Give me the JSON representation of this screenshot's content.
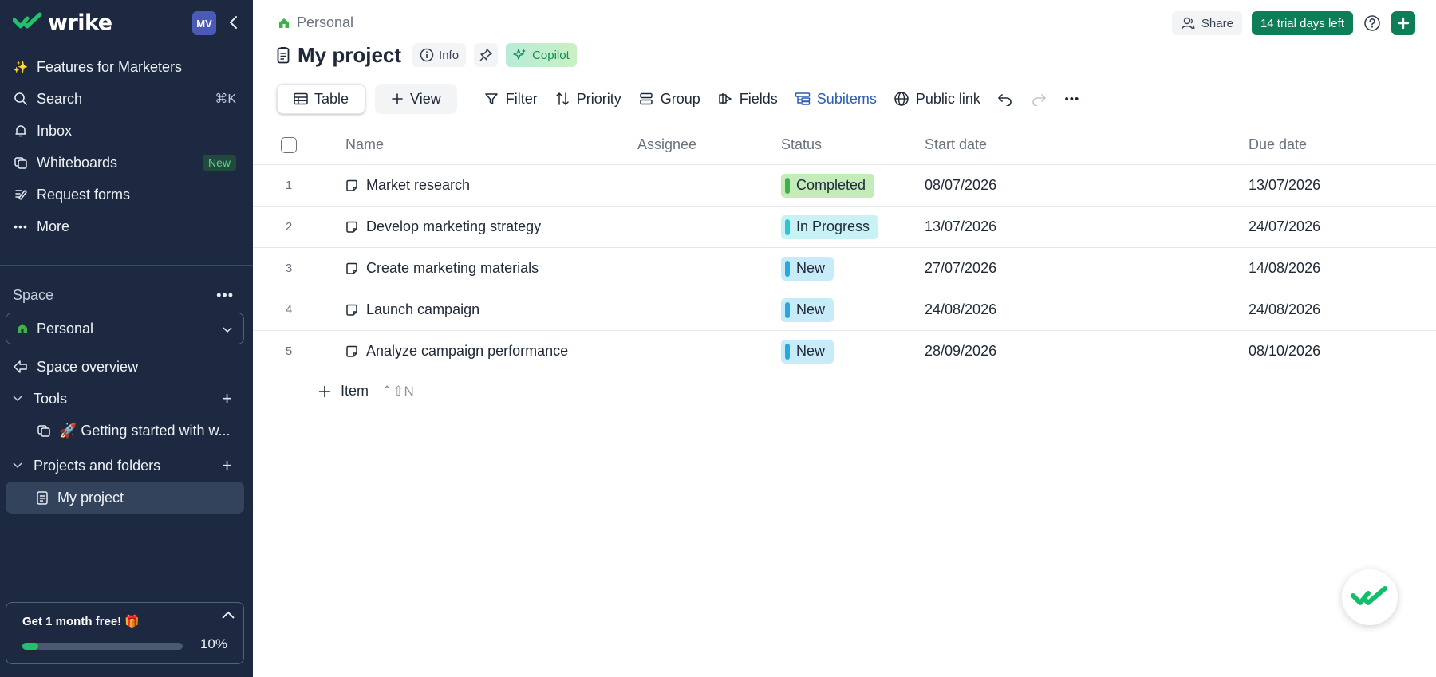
{
  "brand": {
    "name": "wrike",
    "accent": "#0d7e58",
    "sidebar_bg": "#1c2940"
  },
  "user": {
    "initials": "MV"
  },
  "sidebar": {
    "nav": [
      {
        "label": "Features for Marketers",
        "icon": "sparkle-icon"
      },
      {
        "label": "Search",
        "icon": "search-icon",
        "shortcut": "⌘K"
      },
      {
        "label": "Inbox",
        "icon": "bell-icon"
      },
      {
        "label": "Whiteboards",
        "icon": "whiteboard-icon",
        "badge": "New"
      },
      {
        "label": "Request forms",
        "icon": "form-icon"
      },
      {
        "label": "More",
        "icon": "more-icon"
      }
    ],
    "space_heading": "Space",
    "space_selected": "Personal",
    "space_overview": "Space overview",
    "tools_heading": "Tools",
    "tools_item": "🚀 Getting started with w...",
    "projects_heading": "Projects and folders",
    "projects_item": "My project",
    "promo": {
      "title": "Get 1 month free! 🎁",
      "progress_label": "10%",
      "progress": 0.1
    }
  },
  "header": {
    "breadcrumb": "Personal",
    "title": "My project",
    "info_label": "Info",
    "copilot_label": "Copilot",
    "share_label": "Share",
    "trial_label": "14 trial days left"
  },
  "toolbar": {
    "table_label": "Table",
    "view_label": "View",
    "filter_label": "Filter",
    "priority_label": "Priority",
    "group_label": "Group",
    "fields_label": "Fields",
    "subitems_label": "Subitems",
    "public_link_label": "Public link"
  },
  "table": {
    "columns": [
      "Name",
      "Assignee",
      "Status",
      "Start date",
      "Due date"
    ],
    "rows": [
      {
        "num": "1",
        "name": "Market research",
        "assignee": "",
        "status": "Completed",
        "start": "08/07/2026",
        "due": "13/07/2026"
      },
      {
        "num": "2",
        "name": "Develop marketing strategy",
        "assignee": "",
        "status": "In Progress",
        "start": "13/07/2026",
        "due": "24/07/2026"
      },
      {
        "num": "3",
        "name": "Create marketing materials",
        "assignee": "",
        "status": "New",
        "start": "27/07/2026",
        "due": "14/08/2026"
      },
      {
        "num": "4",
        "name": "Launch campaign",
        "assignee": "",
        "status": "New",
        "start": "24/08/2026",
        "due": "24/08/2026"
      },
      {
        "num": "5",
        "name": "Analyze campaign performance",
        "assignee": "",
        "status": "New",
        "start": "28/09/2026",
        "due": "08/10/2026"
      }
    ],
    "add_item_label": "Item",
    "add_item_shortcut": "⌃⇧N"
  }
}
